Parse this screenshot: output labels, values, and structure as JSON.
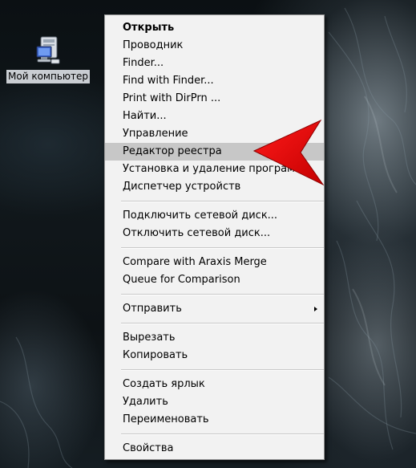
{
  "desktop": {
    "icons": [
      {
        "label": "Мой компьютер",
        "icon": "computer-icon"
      }
    ]
  },
  "context_menu": {
    "groups": [
      {
        "items": [
          {
            "label": "Открыть",
            "bold": true
          },
          {
            "label": "Проводник"
          },
          {
            "label": "Finder..."
          },
          {
            "label": "Find with Finder..."
          },
          {
            "label": "Print with DirPrn ..."
          },
          {
            "label": "Найти..."
          },
          {
            "label": "Управление"
          },
          {
            "label": "Редактор реестра",
            "highlighted": true
          },
          {
            "label": "Установка и удаление программ"
          },
          {
            "label": "Диспетчер устройств"
          }
        ]
      },
      {
        "items": [
          {
            "label": "Подключить сетевой диск..."
          },
          {
            "label": "Отключить сетевой диск..."
          }
        ]
      },
      {
        "items": [
          {
            "label": "Compare with Araxis Merge"
          },
          {
            "label": "Queue for Comparison"
          }
        ]
      },
      {
        "items": [
          {
            "label": "Отправить",
            "submenu": true
          }
        ]
      },
      {
        "items": [
          {
            "label": "Вырезать"
          },
          {
            "label": "Копировать"
          }
        ]
      },
      {
        "items": [
          {
            "label": "Создать ярлык"
          },
          {
            "label": "Удалить"
          },
          {
            "label": "Переименовать"
          }
        ]
      },
      {
        "items": [
          {
            "label": "Свойства"
          }
        ]
      }
    ]
  },
  "annotation": {
    "icon": "red-arrow-pointer",
    "color": "#ff0000"
  },
  "colors": {
    "menu_background": "#f2f2f2",
    "menu_highlight": "#c7c7c7",
    "menu_border": "#979797"
  }
}
